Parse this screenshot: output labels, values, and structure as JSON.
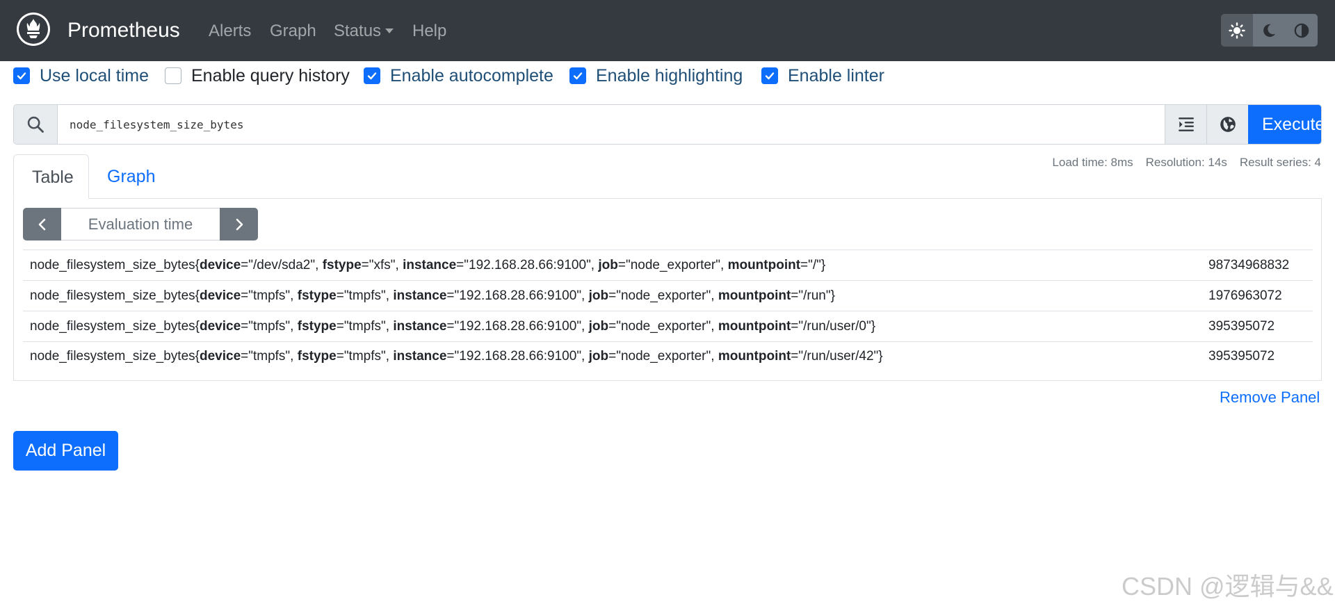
{
  "navbar": {
    "brand": "Prometheus",
    "links": [
      {
        "label": "Alerts"
      },
      {
        "label": "Graph"
      },
      {
        "label": "Status"
      },
      {
        "label": "Help"
      }
    ],
    "theme_buttons": [
      "sun-icon",
      "moon-icon",
      "contrast-icon"
    ]
  },
  "options": [
    {
      "label": "Use local time",
      "checked": true
    },
    {
      "label": "Enable query history",
      "checked": false
    },
    {
      "label": "Enable autocomplete",
      "checked": true
    },
    {
      "label": "Enable highlighting",
      "checked": true
    },
    {
      "label": "Enable linter",
      "checked": true
    }
  ],
  "query": {
    "value": "node_filesystem_size_bytes",
    "execute_label": "Execute"
  },
  "tabs": [
    {
      "label": "Table",
      "active": true
    },
    {
      "label": "Graph",
      "active": false
    }
  ],
  "stats": {
    "load_time": "Load time: 8ms",
    "resolution": "Resolution: 14s",
    "result_series": "Result series: 4"
  },
  "evaluation": {
    "placeholder": "Evaluation time"
  },
  "results": [
    {
      "metric": "node_filesystem_size_bytes",
      "labels": [
        {
          "key": "device",
          "value": "/dev/sda2"
        },
        {
          "key": "fstype",
          "value": "xfs"
        },
        {
          "key": "instance",
          "value": "192.168.28.66:9100"
        },
        {
          "key": "job",
          "value": "node_exporter"
        },
        {
          "key": "mountpoint",
          "value": "/"
        }
      ],
      "value": "98734968832"
    },
    {
      "metric": "node_filesystem_size_bytes",
      "labels": [
        {
          "key": "device",
          "value": "tmpfs"
        },
        {
          "key": "fstype",
          "value": "tmpfs"
        },
        {
          "key": "instance",
          "value": "192.168.28.66:9100"
        },
        {
          "key": "job",
          "value": "node_exporter"
        },
        {
          "key": "mountpoint",
          "value": "/run"
        }
      ],
      "value": "1976963072"
    },
    {
      "metric": "node_filesystem_size_bytes",
      "labels": [
        {
          "key": "device",
          "value": "tmpfs"
        },
        {
          "key": "fstype",
          "value": "tmpfs"
        },
        {
          "key": "instance",
          "value": "192.168.28.66:9100"
        },
        {
          "key": "job",
          "value": "node_exporter"
        },
        {
          "key": "mountpoint",
          "value": "/run/user/0"
        }
      ],
      "value": "395395072"
    },
    {
      "metric": "node_filesystem_size_bytes",
      "labels": [
        {
          "key": "device",
          "value": "tmpfs"
        },
        {
          "key": "fstype",
          "value": "tmpfs"
        },
        {
          "key": "instance",
          "value": "192.168.28.66:9100"
        },
        {
          "key": "job",
          "value": "node_exporter"
        },
        {
          "key": "mountpoint",
          "value": "/run/user/42"
        }
      ],
      "value": "395395072"
    }
  ],
  "remove_panel_label": "Remove Panel",
  "add_panel_label": "Add Panel",
  "watermark": "CSDN @逻辑与&&",
  "colors": {
    "navbar_bg": "#343a40",
    "primary": "#0d6efd",
    "secondary": "#6c757d"
  }
}
